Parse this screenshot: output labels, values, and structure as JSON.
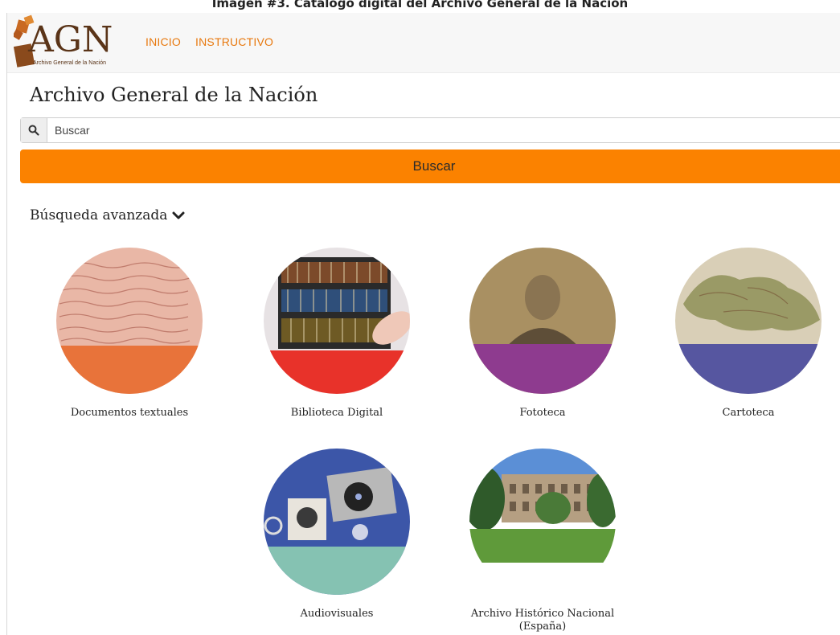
{
  "caption": "Imagen #3. Catálogo digital del Archivo General de la Nación",
  "logo": {
    "text": "AGN",
    "subtitle": "Archivo General de la Nación"
  },
  "nav": [
    {
      "label": "INICIO"
    },
    {
      "label": "INSTRUCTIVO"
    }
  ],
  "page_title": "Archivo General de la Nación",
  "search": {
    "placeholder": "Buscar",
    "button_label": "Buscar"
  },
  "advanced_search": {
    "label": "Búsqueda avanzada"
  },
  "collections": [
    {
      "label": "Documentos textuales",
      "overlay_color": "#e8733a"
    },
    {
      "label": "Biblioteca Digital",
      "overlay_color": "#e8322a"
    },
    {
      "label": "Fototeca",
      "overlay_color": "#8e3b8f"
    },
    {
      "label": "Cartoteca",
      "overlay_color": "#5656a0"
    },
    {
      "label": "Audiovisuales",
      "overlay_color": "#85c2b2"
    },
    {
      "label": "Archivo Histórico Nacional (España)",
      "overlay_color": "#ffffff"
    }
  ],
  "colors": {
    "accent": "#fb8200",
    "nav_link": "#e8790f"
  }
}
